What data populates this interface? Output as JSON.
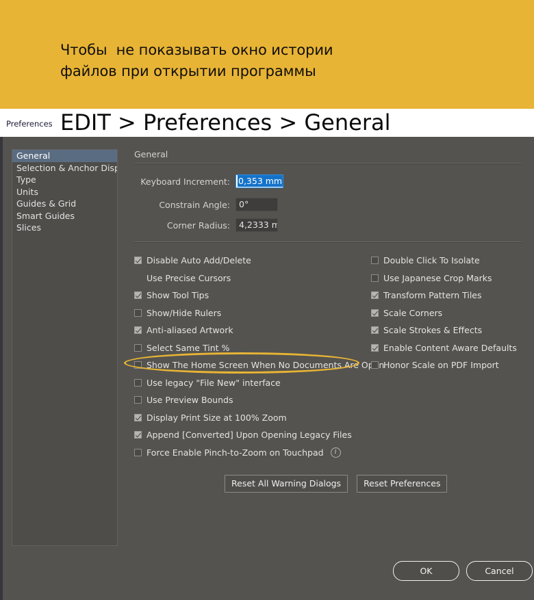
{
  "annotation": {
    "text": "Чтобы  не показывать окно истории\nфайлов при открытии программы",
    "banner_color": "#e8b435"
  },
  "caption": {
    "tab_label": "Preferences",
    "path": "EDIT > Preferences > General"
  },
  "dialog": {
    "background_color": "#54534f",
    "sidebar": {
      "items": [
        {
          "label": "General",
          "selected": true
        },
        {
          "label": "Selection & Anchor Display",
          "selected": false
        },
        {
          "label": "Type",
          "selected": false
        },
        {
          "label": "Units",
          "selected": false
        },
        {
          "label": "Guides & Grid",
          "selected": false
        },
        {
          "label": "Smart Guides",
          "selected": false
        },
        {
          "label": "Slices",
          "selected": false
        }
      ],
      "selected_color": "#5a6c81"
    },
    "main": {
      "section_heading": "General",
      "fields": [
        {
          "label": "Keyboard Increment:",
          "value": "0,353 mm",
          "focused": true
        },
        {
          "label": "Constrain Angle:",
          "value": "0°",
          "focused": false
        },
        {
          "label": "Corner Radius:",
          "value": "4,2333 m",
          "focused": false
        }
      ],
      "checkboxes_left": [
        {
          "label": "Disable Auto Add/Delete",
          "checked": true,
          "has_box": true
        },
        {
          "label": "Use Precise Cursors",
          "checked": false,
          "has_box": false
        },
        {
          "label": "Show Tool Tips",
          "checked": true,
          "has_box": true
        },
        {
          "label": "Show/Hide Rulers",
          "checked": false,
          "has_box": true
        },
        {
          "label": "Anti-aliased Artwork",
          "checked": true,
          "has_box": true
        },
        {
          "label": "Select Same Tint %",
          "checked": false,
          "has_box": true
        },
        {
          "label": "Show The Home Screen When No Documents Are Open",
          "checked": false,
          "has_box": true,
          "highlighted": true
        },
        {
          "label": "Use legacy \"File New\" interface",
          "checked": false,
          "has_box": true
        },
        {
          "label": "Use Preview Bounds",
          "checked": false,
          "has_box": true
        },
        {
          "label": "Display Print Size at 100% Zoom",
          "checked": true,
          "has_box": true
        },
        {
          "label": "Append [Converted] Upon Opening Legacy Files",
          "checked": true,
          "has_box": true
        },
        {
          "label": "Force Enable Pinch-to-Zoom on Touchpad",
          "checked": false,
          "has_box": true,
          "info": "i"
        }
      ],
      "checkboxes_right": [
        {
          "label": "Double Click To Isolate",
          "checked": false,
          "has_box": true
        },
        {
          "label": "Use Japanese Crop Marks",
          "checked": false,
          "has_box": true
        },
        {
          "label": "Transform Pattern Tiles",
          "checked": true,
          "has_box": true
        },
        {
          "label": "Scale Corners",
          "checked": true,
          "has_box": true
        },
        {
          "label": "Scale Strokes & Effects",
          "checked": true,
          "has_box": true
        },
        {
          "label": "Enable Content Aware Defaults",
          "checked": true,
          "has_box": true
        },
        {
          "label": "Honor Scale on PDF Import",
          "checked": false,
          "has_box": true
        }
      ],
      "reset_buttons": [
        {
          "label": "Reset All Warning Dialogs"
        },
        {
          "label": "Reset Preferences"
        }
      ]
    },
    "footer": {
      "ok_label": "OK",
      "cancel_label": "Cancel"
    }
  },
  "highlight": {
    "color": "#e8b435",
    "target": "Show The Home Screen When No Documents Are Open"
  }
}
